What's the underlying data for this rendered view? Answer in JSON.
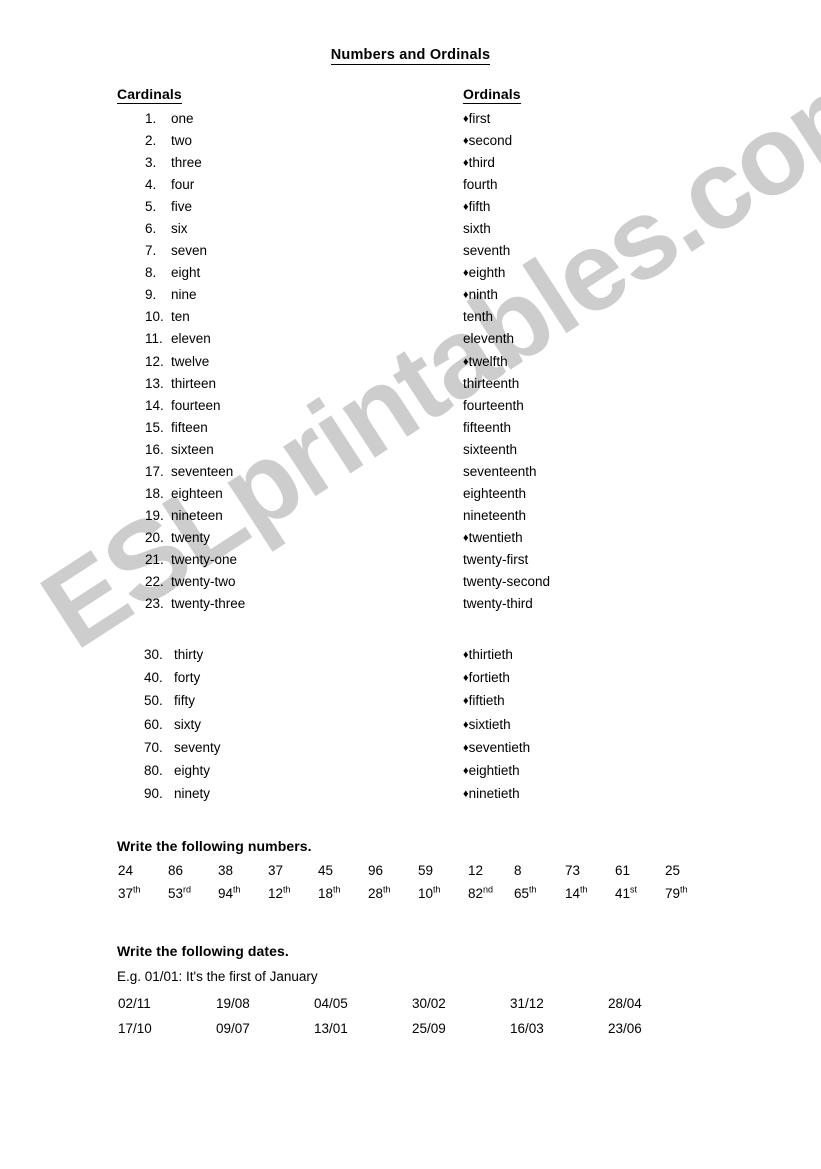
{
  "document": {
    "title": "Numbers and Ordinals"
  },
  "columns": {
    "cardinals_header": "Cardinals",
    "ordinals_header": "Ordinals"
  },
  "bullet_glyph": "♦",
  "main_list": [
    {
      "num": "1.",
      "cardinal": "one",
      "ordinal": "first",
      "bulleted": true
    },
    {
      "num": "2.",
      "cardinal": "two",
      "ordinal": "second",
      "bulleted": true
    },
    {
      "num": "3.",
      "cardinal": "three",
      "ordinal": "third",
      "bulleted": true
    },
    {
      "num": "4.",
      "cardinal": "four",
      "ordinal": "fourth",
      "bulleted": false
    },
    {
      "num": "5.",
      "cardinal": "five",
      "ordinal": "fifth",
      "bulleted": true
    },
    {
      "num": "6.",
      "cardinal": "six",
      "ordinal": "sixth",
      "bulleted": false
    },
    {
      "num": "7.",
      "cardinal": "seven",
      "ordinal": "seventh",
      "bulleted": false
    },
    {
      "num": "8.",
      "cardinal": "eight",
      "ordinal": "eighth",
      "bulleted": true
    },
    {
      "num": "9.",
      "cardinal": "nine",
      "ordinal": "ninth",
      "bulleted": true
    },
    {
      "num": "10.",
      "cardinal": "ten",
      "ordinal": "tenth",
      "bulleted": false
    },
    {
      "num": "11.",
      "cardinal": "eleven",
      "ordinal": "eleventh",
      "bulleted": false
    },
    {
      "num": "12.",
      "cardinal": "twelve",
      "ordinal": "twelfth",
      "bulleted": true
    },
    {
      "num": "13.",
      "cardinal": "thirteen",
      "ordinal": "thirteenth",
      "bulleted": false
    },
    {
      "num": "14.",
      "cardinal": "fourteen",
      "ordinal": "fourteenth",
      "bulleted": false
    },
    {
      "num": "15.",
      "cardinal": "fifteen",
      "ordinal": "fifteenth",
      "bulleted": false
    },
    {
      "num": "16.",
      "cardinal": "sixteen",
      "ordinal": "sixteenth",
      "bulleted": false
    },
    {
      "num": "17.",
      "cardinal": "seventeen",
      "ordinal": "seventeenth",
      "bulleted": false
    },
    {
      "num": "18.",
      "cardinal": "eighteen",
      "ordinal": "eighteenth",
      "bulleted": false
    },
    {
      "num": "19.",
      "cardinal": "nineteen",
      "ordinal": "nineteenth",
      "bulleted": false
    },
    {
      "num": "20.",
      "cardinal": "twenty",
      "ordinal": "twentieth",
      "bulleted": true
    },
    {
      "num": "21.",
      "cardinal": "twenty-one",
      "ordinal": "twenty-first",
      "bulleted": false
    },
    {
      "num": "22.",
      "cardinal": "twenty-two",
      "ordinal": "twenty-second",
      "bulleted": false
    },
    {
      "num": "23.",
      "cardinal": "twenty-three",
      "ordinal": "twenty-third",
      "bulleted": false
    }
  ],
  "tens_list": [
    {
      "num": "30.",
      "cardinal": "thirty",
      "ordinal": "thirtieth",
      "bulleted": true
    },
    {
      "num": "40.",
      "cardinal": "forty",
      "ordinal": "fortieth",
      "bulleted": true
    },
    {
      "num": "50.",
      "cardinal": "fifty",
      "ordinal": "fiftieth",
      "bulleted": true
    },
    {
      "num": "60.",
      "cardinal": "sixty",
      "ordinal": "sixtieth",
      "bulleted": true
    },
    {
      "num": "70.",
      "cardinal": "seventy",
      "ordinal": "seventieth",
      "bulleted": true
    },
    {
      "num": "80.",
      "cardinal": "eighty",
      "ordinal": "eightieth",
      "bulleted": true
    },
    {
      "num": "90.",
      "cardinal": "ninety",
      "ordinal": "ninetieth",
      "bulleted": true
    }
  ],
  "exercise_numbers": {
    "title": "Write the following numbers.",
    "cardinals": [
      "24",
      "86",
      "38",
      "37",
      "45",
      "96",
      "59",
      "12",
      "8",
      "73",
      "61",
      "25"
    ],
    "ordinals": [
      {
        "value": "37",
        "suffix": "th"
      },
      {
        "value": "53",
        "suffix": "rd"
      },
      {
        "value": "94",
        "suffix": "th"
      },
      {
        "value": "12",
        "suffix": "th"
      },
      {
        "value": "18",
        "suffix": "th"
      },
      {
        "value": "28",
        "suffix": "th"
      },
      {
        "value": "10",
        "suffix": "th"
      },
      {
        "value": "82",
        "suffix": "nd"
      },
      {
        "value": "65",
        "suffix": "th"
      },
      {
        "value": "14",
        "suffix": "th"
      },
      {
        "value": "41",
        "suffix": "st"
      },
      {
        "value": "79",
        "suffix": "th"
      }
    ]
  },
  "exercise_dates": {
    "title": "Write the following dates.",
    "example": "E.g.  01/01: It's the first of January",
    "row1": [
      "02/11",
      "19/08",
      "04/05",
      "30/02",
      "31/12",
      "28/04"
    ],
    "row2": [
      "17/10",
      "09/07",
      "13/01",
      "25/09",
      "16/03",
      "23/06"
    ]
  },
  "watermark": {
    "text": "ESLprintables.com",
    "color": "#cdcdcd"
  }
}
